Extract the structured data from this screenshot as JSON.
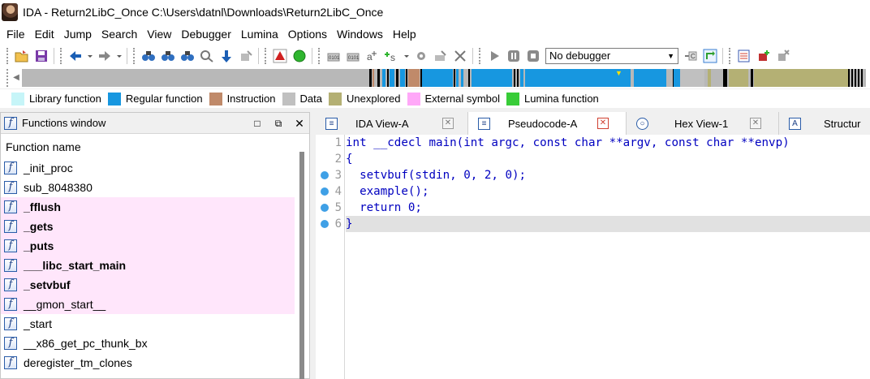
{
  "window": {
    "title": "IDA - Return2LibC_Once C:\\Users\\datnl\\Downloads\\Return2LibC_Once"
  },
  "menu": [
    "File",
    "Edit",
    "Jump",
    "Search",
    "View",
    "Debugger",
    "Lumina",
    "Options",
    "Windows",
    "Help"
  ],
  "toolbar": {
    "debugger_select": "No debugger"
  },
  "legend": [
    {
      "label": "Library function",
      "color": "#c6f5f8"
    },
    {
      "label": "Regular function",
      "color": "#1797e0"
    },
    {
      "label": "Instruction",
      "color": "#c08a6a"
    },
    {
      "label": "Data",
      "color": "#c0c0c0"
    },
    {
      "label": "Unexplored",
      "color": "#b4b074"
    },
    {
      "label": "External symbol",
      "color": "#ffa8f8"
    },
    {
      "label": "Lumina function",
      "color": "#38cc38"
    }
  ],
  "functions_window": {
    "title": "Functions window",
    "column_header": "Function name",
    "items": [
      {
        "name": "_init_proc",
        "bold": false,
        "external": false
      },
      {
        "name": "sub_8048380",
        "bold": false,
        "external": false
      },
      {
        "name": "_fflush",
        "bold": true,
        "external": true
      },
      {
        "name": "_gets",
        "bold": true,
        "external": true
      },
      {
        "name": "_puts",
        "bold": true,
        "external": true
      },
      {
        "name": "___libc_start_main",
        "bold": true,
        "external": true
      },
      {
        "name": "_setvbuf",
        "bold": true,
        "external": true
      },
      {
        "name": "__gmon_start__",
        "bold": false,
        "external": true
      },
      {
        "name": "_start",
        "bold": false,
        "external": false
      },
      {
        "name": "__x86_get_pc_thunk_bx",
        "bold": false,
        "external": false
      },
      {
        "name": "deregister_tm_clones",
        "bold": false,
        "external": false
      }
    ]
  },
  "tabs": [
    {
      "label": "IDA View-A",
      "active": false,
      "icon": "ida-view-icon"
    },
    {
      "label": "Pseudocode-A",
      "active": true,
      "icon": "pseudocode-icon"
    },
    {
      "label": "Hex View-1",
      "active": false,
      "icon": "hex-view-icon"
    },
    {
      "label": "Structur",
      "active": false,
      "icon": "structures-icon"
    }
  ],
  "code": [
    {
      "line": "1",
      "text": "int __cdecl main(int argc, const char **argv, const char **envp)",
      "breakpoint": false
    },
    {
      "line": "2",
      "text": "{",
      "breakpoint": false
    },
    {
      "line": "3",
      "text": "  setvbuf(stdin, 0, 2, 0);",
      "breakpoint": true
    },
    {
      "line": "4",
      "text": "  example();",
      "breakpoint": true
    },
    {
      "line": "5",
      "text": "  return 0;",
      "breakpoint": true
    },
    {
      "line": "6",
      "text": "}",
      "breakpoint": true
    }
  ],
  "current_line": 6
}
